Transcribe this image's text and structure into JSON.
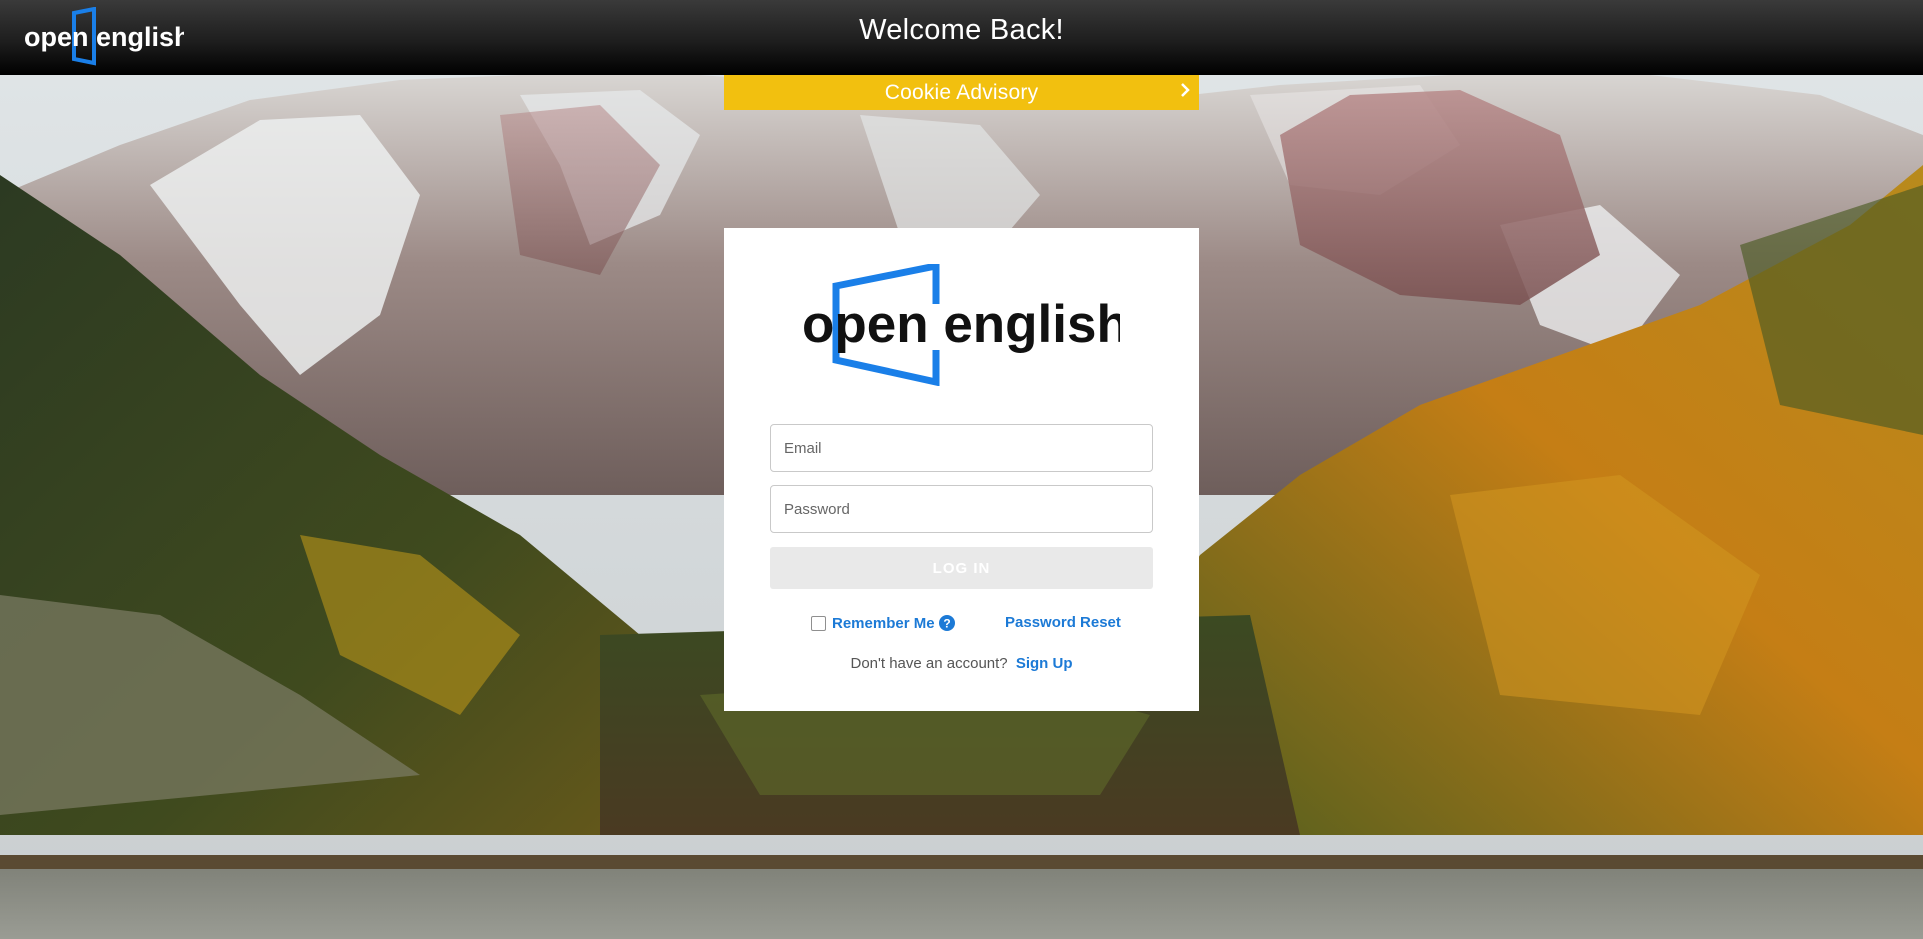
{
  "header": {
    "logo_text": "open english",
    "title": "Welcome Back!"
  },
  "cookie_banner": {
    "label": "Cookie Advisory",
    "icon": "chevron-right-icon"
  },
  "login": {
    "logo_text": "open english",
    "email_placeholder": "Email",
    "password_placeholder": "Password",
    "login_label": "LOG IN",
    "remember_label": "Remember Me",
    "help_icon": "question-circle-icon",
    "password_reset_label": "Password Reset",
    "no_account_text": "Don't have an account?",
    "signup_label": "Sign Up"
  },
  "colors": {
    "brand_blue": "#1a7fe8",
    "link_blue": "#1c7ad6",
    "cookie_yellow": "#f2c00f",
    "disabled_button": "#e9e9e9",
    "topbar_dark": "#1e1e1e"
  }
}
